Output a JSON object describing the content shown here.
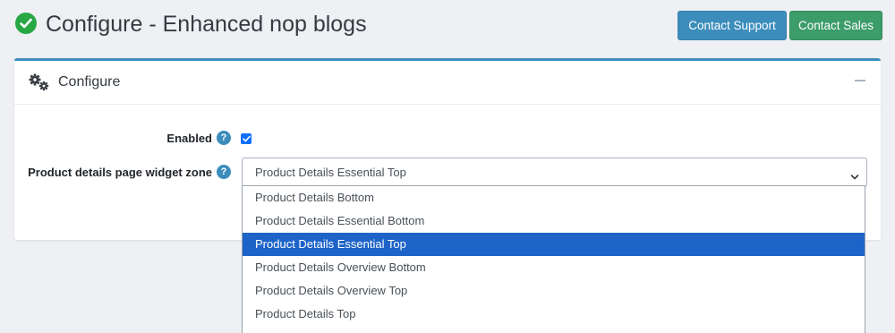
{
  "header": {
    "title": "Configure - Enhanced nop blogs",
    "contact_support_label": "Contact Support",
    "contact_sales_label": "Contact Sales"
  },
  "card": {
    "title": "Configure"
  },
  "form": {
    "enabled_label": "Enabled",
    "enabled_checked": true,
    "widget_zone_label": "Product details page widget zone",
    "widget_zone_value": "Product Details Essential Top",
    "help_glyph": "?"
  },
  "dropdown": {
    "options": [
      "Product Details Bottom",
      "Product Details Essential Bottom",
      "Product Details Essential Top",
      "Product Details Overview Bottom",
      "Product Details Overview Top",
      "Product Details Top"
    ],
    "selected_index": 2
  },
  "colors": {
    "accent": "#3c8dbc",
    "success": "#28a745",
    "sales_button": "#3c9c6a",
    "selected_option": "#1e64c8"
  },
  "icons": {
    "title": "check-circle-icon",
    "card": "gears-icon",
    "collapse": "minus-icon",
    "help": "question-circle-icon",
    "select": "chevron-down-icon"
  }
}
